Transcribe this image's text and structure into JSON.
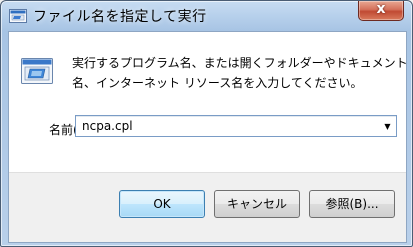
{
  "window": {
    "title": "ファイル名を指定して実行",
    "close_label": "x"
  },
  "description": {
    "line1": "実行するプログラム名、または開くフォルダーやドキュメント",
    "line2": "名、インターネット リソース名を入力してください。"
  },
  "name_field": {
    "label": "名前(O):",
    "value": "ncpa.cpl"
  },
  "buttons": {
    "ok": "OK",
    "cancel": "キャンセル",
    "browse": "参照(B)..."
  },
  "icons": {
    "title": "run-app-icon",
    "body": "run-dialog-icon",
    "dropdown": "chevron-down-icon",
    "close": "close-icon"
  }
}
